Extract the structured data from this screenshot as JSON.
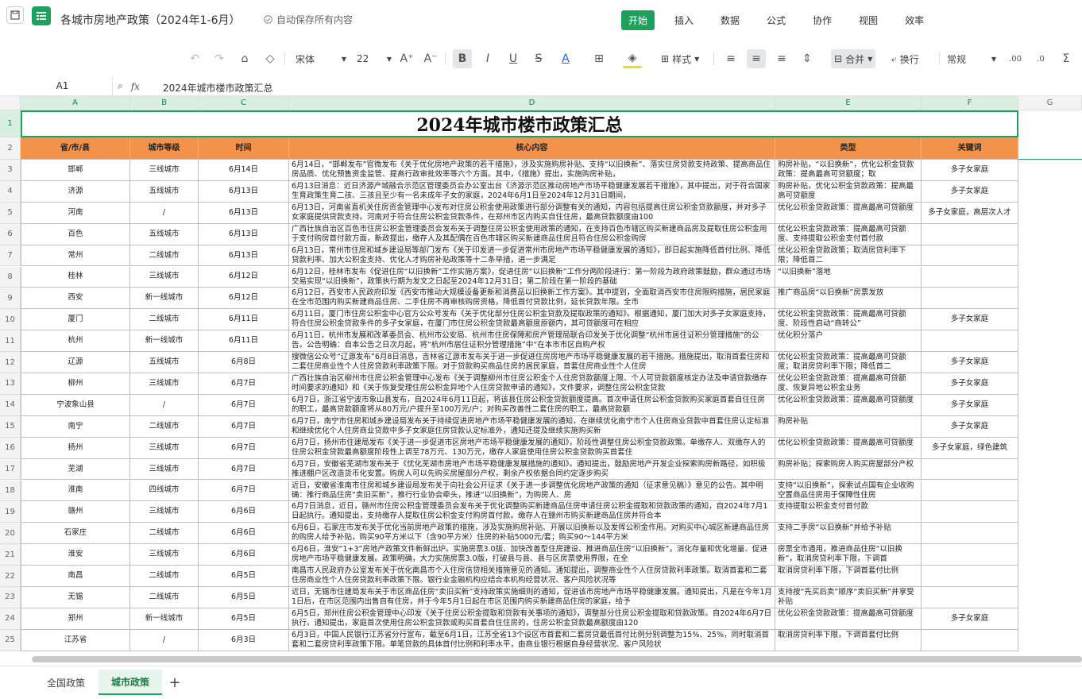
{
  "titlebar": {
    "doc_title": "各城市房地产政策（2024年1-6月）",
    "autosave": "自动保存所有内容",
    "menu": [
      "开始",
      "插入",
      "数据",
      "公式",
      "协作",
      "视图",
      "效率"
    ],
    "active_menu": "开始"
  },
  "toolbar": {
    "font": "宋体",
    "size": "22",
    "style_label": "样式",
    "merge_label": "合并",
    "wrap_label": "换行",
    "format_label": "常规"
  },
  "formula": {
    "cellref": "A1",
    "fx": "fx",
    "content": "2024年城市楼市政策汇总"
  },
  "columns": [
    "A",
    "B",
    "C",
    "D",
    "E",
    "F",
    "G"
  ],
  "sheet": {
    "title": "2024年城市楼市政策汇总",
    "headers": [
      "省/市/县",
      "城市等级",
      "时间",
      "核心内容",
      "类型",
      "关键词"
    ],
    "rows": [
      [
        "邯郸",
        "三线城市",
        "6月14日",
        "6月14日，“邯郸发布”官微发布《关于优化房地产政策的若干措施》，涉及实施购房补贴、支持“以旧换新”、落实住房贷款支持政策、提高商品住房品质、优化预售资金监管、提高行政审批效率等六个方面。其中，《措施》提出，实施购房补贴，",
        "购房补贴，“以旧换新”，优化公积金贷款政策：提高最高可贷额度；取",
        "多子女家庭"
      ],
      [
        "济源",
        "五线城市",
        "6月13日",
        "6月13日消息：近日济源产城融合示范区管理委员会办公室出台《济源示范区推动房地产市场平稳健康发展若干措施》，其中提出，对于符合国家生育政策生育二孩、三孩且至少有一名未成年子女的家庭，2024年6月1日至2024年12月31日期间，",
        "购房补贴，优化公积金贷款政策：提高最高可贷额度",
        "多子女家庭"
      ],
      [
        "河南",
        "/",
        "6月13日",
        "6月13日，河南省直机关住房资金管理中心发布对住房公积金使用政策进行部分调整有关的通知，内容包括提高住房公积金贷款额度，并对多子女家庭提供贷款支持。河南对于符合住房公积金贷款条件，在郑州市区内购买自住住房，最高贷款额度由100",
        "优化公积金贷款政策：提高最高可贷额度",
        "多子女家庭，高层次人才"
      ],
      [
        "百色",
        "五线城市",
        "6月13日",
        "广西壮族自治区百色市住房公积金管理委员会发布关于调整住房公积金使用政策的通知，在支持百色市辖区购买新建商品房及提取住房公积金用于支付购房首付款方面，新政提出，缴存人及其配偶在百色市辖区购买新建商品住房且符合住房公积金购房",
        "优化公积金贷款政策：提高最高可贷额度、支持提取公积金支付首付款",
        ""
      ],
      [
        "常州",
        "二线城市",
        "6月13日",
        "6月13日，常州市住房和城乡建设局等部门发布《关于印发进一步促进常州市房地产市场平稳健康发展的通知》，即日起实施降低首付比例、降低贷款利率、加大公积金支持、优化人才购房补贴政策等十二条举措，进一步满足",
        "优化公积金贷款政策；取消房贷利率下限；降低首二",
        ""
      ],
      [
        "桂林",
        "三线城市",
        "6月12日",
        "6月12日，桂林市发布《促进住房“以旧换新”工作实施方案》，促进住房“以旧换新”工作分两阶段进行：第一阶段为政府政策鼓励，群众通过市场交易实现“以旧换新”，政策执行期为发文之日起至2024年12月31日；第二阶段在第一阶段的基础",
        "“以旧换新”落地",
        ""
      ],
      [
        "西安",
        "新一线城市",
        "6月12日",
        "6月12日，西安市人民政府印发《西安市推动大规模设备更新和消费品以旧换新工作方案》。其中提到，全面取消西安市住房限购措施，居民家庭在全市范围内购买新建商品住房、二手住房不再审核购房资格，降低首付贷款比例，延长贷款年限。全市",
        "推广商品房“以旧换新”房票发放",
        ""
      ],
      [
        "厦门",
        "二线城市",
        "6月11日",
        "6月11日，厦门市住房公积金中心官方公众号发布《关于优化部分住房公积金贷款及提取政策的通知》。根据通知，厦门加大对多子女家庭支持，符合住房公积金贷款条件的多子女家庭，在厦门市住房公积金贷款最高额度原额内，其可贷额度可在相应",
        "优化公积金贷款政策：提高最高可贷额度、阶段性启动“商转公”",
        "多子女家庭"
      ],
      [
        "杭州",
        "新一线城市",
        "6月11日",
        "6月11日，杭州市发展和改革委员会、杭州市公安局、杭州市住房保障和房产管理局联合印发关于优化调整“杭州市居住证积分管理措施”的公告。公告明确：自本公告之日次月起，将“杭州市居住证积分管理措施”中“在本市市区自购产权",
        "优化积分落户",
        ""
      ],
      [
        "辽源",
        "五线城市",
        "6月8日",
        "搜微信公众号“辽源发布”6月8日消息，吉林省辽源市发布关于进一步促进住房房地产市场平稳健康发展的若干措施。措施提出，取消首套住房和二套住房商业性个人住房贷款利率政策下限。对于贷款购买商品住房的居民家庭，首套住房商业性个人住房",
        "优化公积金贷款政策：提高最高可贷额度；取消房贷利率下限；降低首二",
        "多子女家庭"
      ],
      [
        "柳州",
        "三线城市",
        "6月7日",
        "广西壮族自治区柳州市住房公积金管理中心发布《关于调整柳州市住房公积金个人住房贷款额度上限、个人可贷款额度核定办法及申请贷款缴存时间要求的通知》和《关于恢复受理住房公积金异地个人住房贷款申请的通知》，文件要求，调整住房公积金贷款",
        "优化公积金贷款政策：提高最高可贷额度、恢复异地公积金业务",
        "多子女家庭"
      ],
      [
        "宁波象山县",
        "/",
        "6月7日",
        "6月7日，浙江省宁波市象山县发布，自2024年6月11日起，将该县住房公积金贷款额度提高。首次申请住房公积金贷款购买家庭首套自住住房的职工，最高贷款额度将从80万元/户提升至100万元/户；对购买改善性二套住房的职工，最高贷款额",
        "优化公积金贷款政策：提高最高可贷额度",
        "多子女家庭"
      ],
      [
        "南宁",
        "二线城市",
        "6月7日",
        "6月7日，南宁市住房和城乡建设局发布关于持续促进房地产市场平稳健康发展的通知，在继续优化南宁市个人住房商业贷款中首套住房认定标准和继续优化个人住房商业贷款中多子女家庭住房贷款认定标准外，通知还提及继续实施购买新",
        "购房补贴",
        "多子女家庭"
      ],
      [
        "扬州",
        "三线城市",
        "6月7日",
        "6月7日，扬州市住建局发布《关于进一步促进市区房地产市场平稳健康发展的通知》，阶段性调整住房公积金贷款政策。单缴存人、双缴存人的住房公积金贷款最高额度阶段性上调至78万元、130万元，缴存人家庭使用住房公积金贷款购买首套住",
        "优化公积金贷款政策：提高最高可贷额度",
        "多子女家庭，绿色建筑"
      ],
      [
        "芜湖",
        "三线城市",
        "6月7日",
        "6月7日，安徽省芜湖市发布关于《优化芜湖市房地产市场平稳健康发展措施的通知》。通知提出，鼓励房地产开发企业探索购房新路径，如积极推进棚户区改造货币化安置。购房人可以先购买房屋部分产权，剩余产权依据合同约定逐步购买",
        "购房补贴；探索购房人购买房屋部分产权",
        ""
      ],
      [
        "淮南",
        "四线城市",
        "6月7日",
        "近日，安徽省淮南市住房和城乡建设局发布关于向社会公开征求《关于进一步调整优化房地产政策的通知（征求意见稿）》意见的公告。其中明确：推行商品住房“卖旧买新”，推行行业协会牵头，推进“以旧换新”，为购房人、房",
        "支持“以旧换新”，探索试点国有企业收购空置商品住房用于保障性住房",
        ""
      ],
      [
        "赣州",
        "三线城市",
        "6月6日",
        "6月7日消息，近日，赣州市住房公积金管理委员会发布关于优化调整购买新建商品住房申请住房公积金提取和贷款政策的通知，自2024年7月1日起执行。通知提出，支持缴存人提取住房公积金支付购房首付款。缴存人在赣州市购买新建商品住房并符合本",
        "支持提取公积金支付首付款",
        ""
      ],
      [
        "石家庄",
        "二线城市",
        "6月6日",
        "6月6日，石家庄市发布关于优化当前房地产政策的措施，涉及实施购房补贴、开展以旧换新以及发挥公积金作用。对购买中心城区新建商品住房的购房人给予补贴，购买90平方米以下（含90平方米）住房的补贴5000元/套；购买90～144平方米",
        "支持二手房“以旧换新”并给予补贴",
        ""
      ],
      [
        "淮安",
        "三线城市",
        "6月6日",
        "6月6日，淮安“1+3”房地产政策文件新鲜出炉。实施房票3.0版、加快改善型住房建设、推进商品住房“以旧换新”，消化存量和优化增量、促进房地产市场平稳健康发展。政策明确，大力实施房票3.0版，打破县与县、县与区房票使用界限，在全",
        "房票全市通用，推进商品住房“以旧换新”，取消房贷利率下限，下调首",
        ""
      ],
      [
        "南昌",
        "二线城市",
        "6月5日",
        "南昌市人民政府办公室发布关于优化南昌市个人住房信贷相关措施意见的通知。通知提出，调整商业性个人住房贷款利率政策。取消首套和二套住房商业性个人住房贷款利率政策下限。银行业金融机构应结合本机构经营状况、客户风险状况等",
        "取消房贷利率下限，下调首套付比例",
        ""
      ],
      [
        "无锡",
        "二线城市",
        "6月5日",
        "近日，无锡市住建局发布关于市区商品住房“卖旧买新”支持政策实施细则的通知，促进该市房地产市场平稳健康发展。通知提出，凡是在今年1月1日后，在市区范围内出售自有住房，并于今年5月1日起在市区范围内购买新建商品住房的家庭，给予",
        "支持按“先买后卖”顺序“卖旧买新”并享受补贴",
        ""
      ],
      [
        "郑州",
        "新一线城市",
        "6月5日",
        "6月5日，郑州住房公积金管理中心印发《关于住房公积金提取和贷款有关事项的通知》，调整部分住房公积金提取和贷款政策。自2024年6月7日执行。通知提出，家庭首次使用住房公积金贷款或购买首套自住住房的，住房公积金贷款最高额度由120",
        "优化公积金贷款政策：提高最高可贷额度",
        "多子女家庭"
      ],
      [
        "江苏省",
        "/",
        "6月3日",
        "6月3日，中国人民银行江苏省分行宣布，截至6月1日，江苏全省13个设区市首套和二套房贷最低首付比例分别调整为15%、25%，同时取消首套和二套房贷利率政策下限。单笔贷款的具体首付比例和利率水平，由商业银行根据自身经营状况、客户风险状",
        "取消房贷利率下限，下调首套付比例",
        ""
      ]
    ]
  },
  "sheets": [
    "全国政策",
    "城市政策"
  ],
  "active_sheet": "城市政策",
  "add_sheet": "+"
}
